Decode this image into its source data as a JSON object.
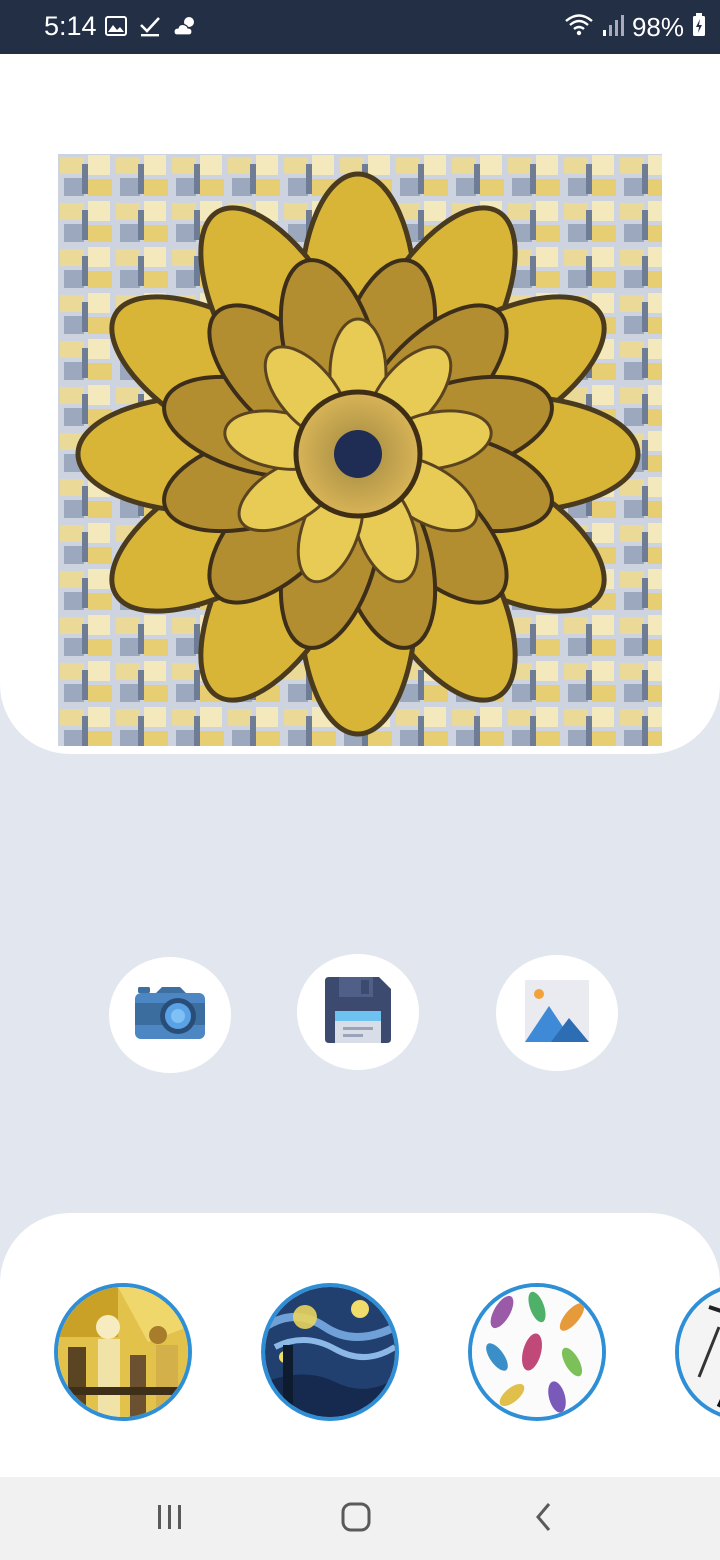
{
  "status_bar": {
    "time": "5:14",
    "battery_percent": "98%",
    "icons_left": [
      "image-icon",
      "check-icon",
      "weather-cloud-sun-icon"
    ],
    "icons_right": [
      "wifi-icon",
      "signal-icon",
      "battery-charging-icon"
    ]
  },
  "main_image": {
    "description_icon": "stylized-sunflower-image"
  },
  "actions": {
    "buttons": [
      {
        "name": "camera",
        "icon": "camera-icon"
      },
      {
        "name": "save",
        "icon": "floppy-disk-icon"
      },
      {
        "name": "gallery",
        "icon": "image-gallery-icon"
      }
    ]
  },
  "styles": {
    "items": [
      {
        "name": "cubist-abstract",
        "icon": "style-thumbnail"
      },
      {
        "name": "starry-night",
        "icon": "style-thumbnail"
      },
      {
        "name": "watercolor-feathers",
        "icon": "style-thumbnail"
      },
      {
        "name": "sketch",
        "icon": "style-thumbnail"
      }
    ],
    "border_color": "#2f8fd6"
  },
  "navigation": {
    "buttons": [
      "recent-apps-icon",
      "home-icon",
      "back-icon"
    ]
  },
  "colors": {
    "status_bar": "#232f45",
    "background": "#e2e7ef",
    "card": "#ffffff",
    "accent_blue": "#2f8fd6"
  }
}
